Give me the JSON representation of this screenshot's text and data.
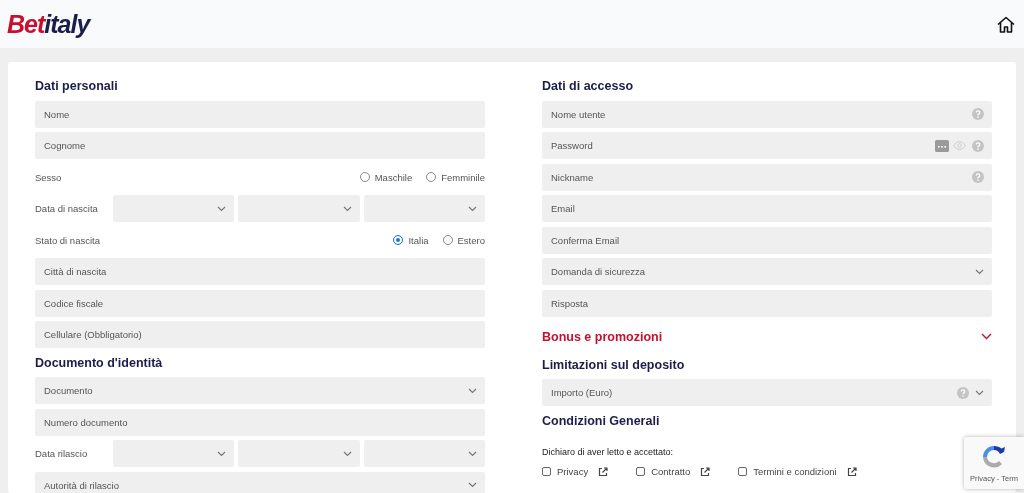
{
  "header": {
    "logo": {
      "first": "Bet",
      "second": "italy"
    }
  },
  "columns": [
    {
      "blocks": [
        {
          "kind": "heading",
          "text": "Dati personali"
        },
        {
          "kind": "input",
          "placeholder": "Nome"
        },
        {
          "kind": "input",
          "placeholder": "Cognome"
        },
        {
          "kind": "radio",
          "label": "Sesso",
          "options": [
            {
              "label": "Maschile",
              "selected": false
            },
            {
              "label": "Femminile",
              "selected": false
            }
          ]
        },
        {
          "kind": "date",
          "label": "Data di nascita"
        },
        {
          "kind": "radio",
          "label": "Stato di nascita",
          "options": [
            {
              "label": "Italia",
              "selected": true
            },
            {
              "label": "Estero",
              "selected": false
            }
          ]
        },
        {
          "kind": "input",
          "placeholder": "Città di nascita"
        },
        {
          "kind": "input",
          "placeholder": "Codice fiscale"
        },
        {
          "kind": "input",
          "placeholder": "Cellulare (Obbligatorio)"
        },
        {
          "kind": "heading",
          "text": "Documento d'identità"
        },
        {
          "kind": "select",
          "placeholder": "Documento"
        },
        {
          "kind": "input",
          "placeholder": "Numero documento"
        },
        {
          "kind": "date",
          "label": "Data rilascio"
        },
        {
          "kind": "select",
          "placeholder": "Autorità di rilascio"
        }
      ]
    },
    {
      "blocks": [
        {
          "kind": "heading",
          "text": "Dati di accesso"
        },
        {
          "kind": "input",
          "placeholder": "Nome utente",
          "help": true
        },
        {
          "kind": "input",
          "placeholder": "Password",
          "help": true,
          "password_tools": true
        },
        {
          "kind": "input",
          "placeholder": "Nickname",
          "help": true
        },
        {
          "kind": "input",
          "placeholder": "Email"
        },
        {
          "kind": "input",
          "placeholder": "Conferma Email"
        },
        {
          "kind": "select",
          "placeholder": "Domanda di sicurezza"
        },
        {
          "kind": "input",
          "placeholder": "Risposta"
        },
        {
          "kind": "toggle",
          "text": "Bonus e promozioni",
          "expanded": false
        },
        {
          "kind": "heading",
          "text": "Limitazioni sul deposito"
        },
        {
          "kind": "select",
          "placeholder": "Importo (Euro)",
          "help": true
        },
        {
          "kind": "heading",
          "text": "Condizioni Generali"
        },
        {
          "kind": "text",
          "text": "Dichiaro di aver letto e accettato:"
        },
        {
          "kind": "checks",
          "items": [
            {
              "label": "Privacy",
              "checked": false
            },
            {
              "label": "Contratto",
              "checked": false
            },
            {
              "label": "Termini e condizioni",
              "checked": false
            }
          ]
        }
      ]
    }
  ],
  "recaptcha": {
    "text": "Privacy - Term"
  }
}
